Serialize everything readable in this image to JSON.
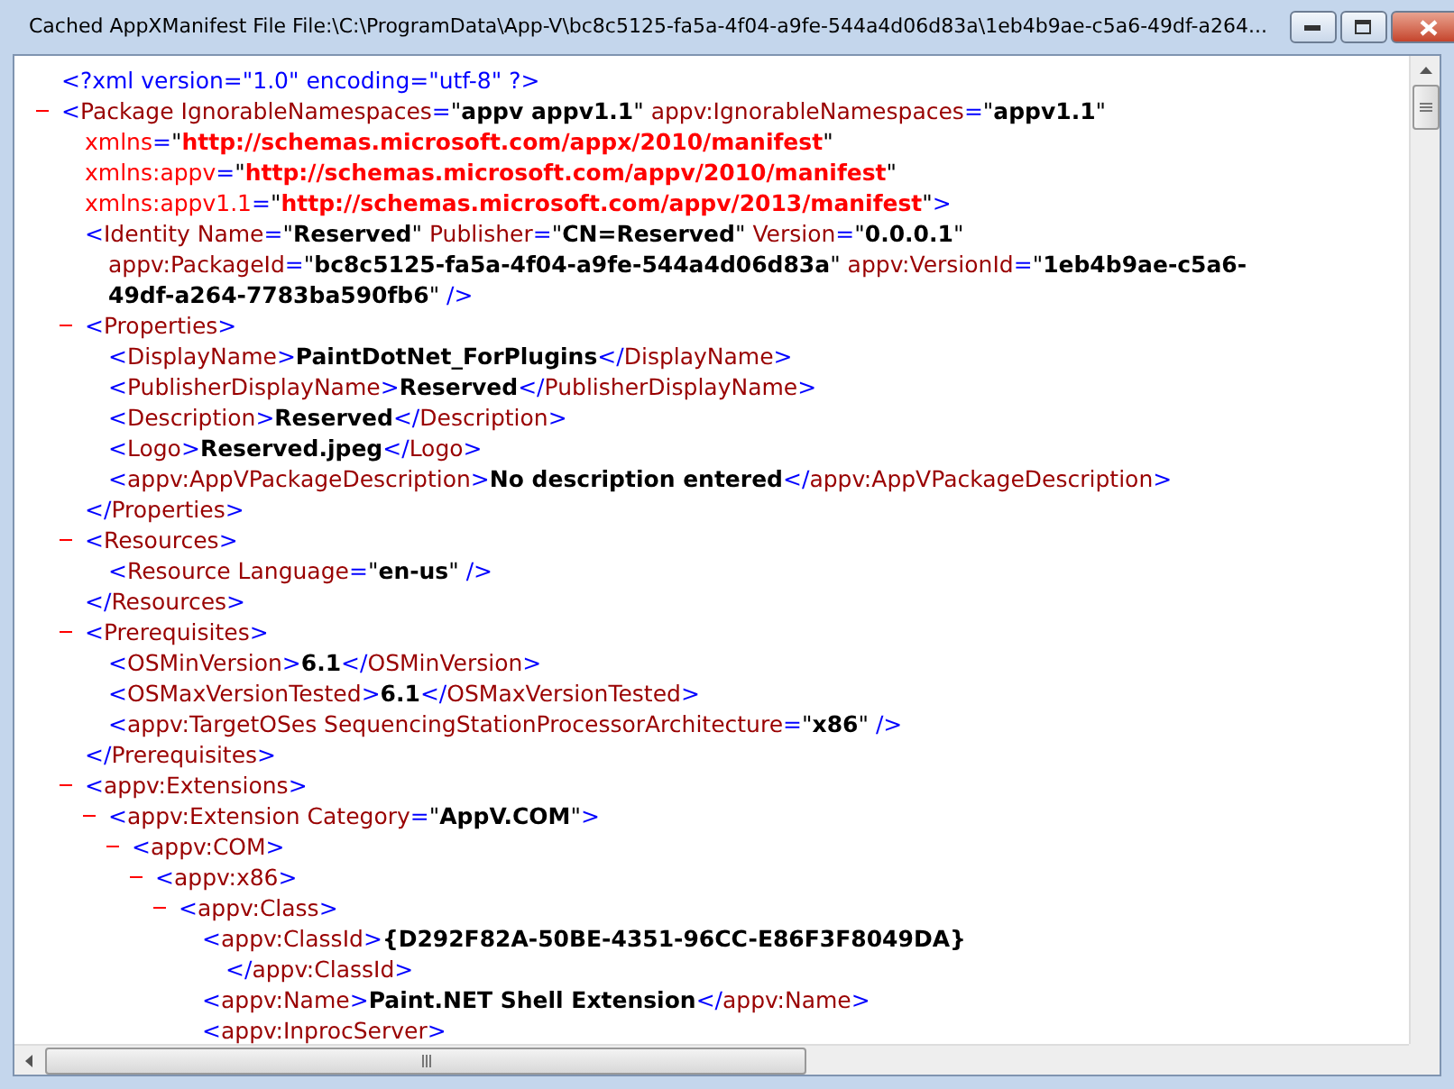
{
  "window": {
    "title": "Cached AppXManifest File File:\\C:\\ProgramData\\App-V\\bc8c5125-fa5a-4f04-a9fe-544a4d06d83a\\1eb4b9ae-c5a6-49df-a264..."
  },
  "document": [
    {
      "lines": [
        [
          {
            "kind": "punct",
            "text": "<?xml version=\"1.0\" encoding=\"utf-8\" ?>"
          }
        ]
      ]
    },
    {
      "expanded": true,
      "lines": [
        [
          {
            "kind": "punct",
            "text": "<"
          },
          {
            "kind": "name",
            "text": "Package IgnorableNamespaces"
          },
          {
            "kind": "punct",
            "text": "="
          },
          {
            "kind": "quote",
            "text": "\""
          },
          {
            "kind": "value",
            "text": "appv appv1.1"
          },
          {
            "kind": "quote",
            "text": "\""
          },
          {
            "kind": "name",
            "text": " appv:IgnorableNamespaces"
          },
          {
            "kind": "punct",
            "text": "="
          },
          {
            "kind": "quote",
            "text": "\""
          },
          {
            "kind": "value",
            "text": "appv1.1"
          },
          {
            "kind": "quote",
            "text": "\""
          }
        ],
        [
          {
            "kind": "nsname",
            "text": "xmlns"
          },
          {
            "kind": "punct",
            "text": "="
          },
          {
            "kind": "quote",
            "text": "\""
          },
          {
            "kind": "url",
            "text": "http://schemas.microsoft.com/appx/2010/manifest"
          },
          {
            "kind": "quote",
            "text": "\""
          }
        ],
        [
          {
            "kind": "nsname",
            "text": "xmlns:appv"
          },
          {
            "kind": "punct",
            "text": "="
          },
          {
            "kind": "quote",
            "text": "\""
          },
          {
            "kind": "url",
            "text": "http://schemas.microsoft.com/appv/2010/manifest"
          },
          {
            "kind": "quote",
            "text": "\""
          }
        ],
        [
          {
            "kind": "nsname",
            "text": "xmlns:appv1.1"
          },
          {
            "kind": "punct",
            "text": "="
          },
          {
            "kind": "quote",
            "text": "\""
          },
          {
            "kind": "url",
            "text": "http://schemas.microsoft.com/appv/2013/manifest"
          },
          {
            "kind": "quote",
            "text": "\""
          },
          {
            "kind": "punct",
            "text": ">"
          }
        ]
      ],
      "children": [
        {
          "lines": [
            [
              {
                "kind": "punct",
                "text": "<"
              },
              {
                "kind": "name",
                "text": "Identity Name"
              },
              {
                "kind": "punct",
                "text": "="
              },
              {
                "kind": "quote",
                "text": "\""
              },
              {
                "kind": "value",
                "text": "Reserved"
              },
              {
                "kind": "quote",
                "text": "\""
              },
              {
                "kind": "name",
                "text": " Publisher"
              },
              {
                "kind": "punct",
                "text": "="
              },
              {
                "kind": "quote",
                "text": "\""
              },
              {
                "kind": "value",
                "text": "CN=Reserved"
              },
              {
                "kind": "quote",
                "text": "\""
              },
              {
                "kind": "name",
                "text": " Version"
              },
              {
                "kind": "punct",
                "text": "="
              },
              {
                "kind": "quote",
                "text": "\""
              },
              {
                "kind": "value",
                "text": "0.0.0.1"
              },
              {
                "kind": "quote",
                "text": "\""
              }
            ],
            [
              {
                "kind": "name",
                "text": "appv:PackageId"
              },
              {
                "kind": "punct",
                "text": "="
              },
              {
                "kind": "quote",
                "text": "\""
              },
              {
                "kind": "value",
                "text": "bc8c5125-fa5a-4f04-a9fe-544a4d06d83a"
              },
              {
                "kind": "quote",
                "text": "\""
              },
              {
                "kind": "name",
                "text": " appv:VersionId"
              },
              {
                "kind": "punct",
                "text": "="
              },
              {
                "kind": "quote",
                "text": "\""
              },
              {
                "kind": "value",
                "text": "1eb4b9ae-c5a6-"
              }
            ],
            [
              {
                "kind": "value",
                "text": "49df-a264-7783ba590fb6"
              },
              {
                "kind": "quote",
                "text": "\""
              },
              {
                "kind": "punct",
                "text": " />"
              }
            ]
          ]
        },
        {
          "expanded": true,
          "lines": [
            [
              {
                "kind": "punct",
                "text": "<"
              },
              {
                "kind": "name",
                "text": "Properties"
              },
              {
                "kind": "punct",
                "text": ">"
              }
            ]
          ],
          "children": [
            {
              "lines": [
                [
                  {
                    "kind": "punct",
                    "text": "<"
                  },
                  {
                    "kind": "name",
                    "text": "DisplayName"
                  },
                  {
                    "kind": "punct",
                    "text": ">"
                  },
                  {
                    "kind": "value",
                    "text": "PaintDotNet_ForPlugins"
                  },
                  {
                    "kind": "punct",
                    "text": "</"
                  },
                  {
                    "kind": "name",
                    "text": "DisplayName"
                  },
                  {
                    "kind": "punct",
                    "text": ">"
                  }
                ]
              ]
            },
            {
              "lines": [
                [
                  {
                    "kind": "punct",
                    "text": "<"
                  },
                  {
                    "kind": "name",
                    "text": "PublisherDisplayName"
                  },
                  {
                    "kind": "punct",
                    "text": ">"
                  },
                  {
                    "kind": "value",
                    "text": "Reserved"
                  },
                  {
                    "kind": "punct",
                    "text": "</"
                  },
                  {
                    "kind": "name",
                    "text": "PublisherDisplayName"
                  },
                  {
                    "kind": "punct",
                    "text": ">"
                  }
                ]
              ]
            },
            {
              "lines": [
                [
                  {
                    "kind": "punct",
                    "text": "<"
                  },
                  {
                    "kind": "name",
                    "text": "Description"
                  },
                  {
                    "kind": "punct",
                    "text": ">"
                  },
                  {
                    "kind": "value",
                    "text": "Reserved"
                  },
                  {
                    "kind": "punct",
                    "text": "</"
                  },
                  {
                    "kind": "name",
                    "text": "Description"
                  },
                  {
                    "kind": "punct",
                    "text": ">"
                  }
                ]
              ]
            },
            {
              "lines": [
                [
                  {
                    "kind": "punct",
                    "text": "<"
                  },
                  {
                    "kind": "name",
                    "text": "Logo"
                  },
                  {
                    "kind": "punct",
                    "text": ">"
                  },
                  {
                    "kind": "value",
                    "text": "Reserved.jpeg"
                  },
                  {
                    "kind": "punct",
                    "text": "</"
                  },
                  {
                    "kind": "name",
                    "text": "Logo"
                  },
                  {
                    "kind": "punct",
                    "text": ">"
                  }
                ]
              ]
            },
            {
              "lines": [
                [
                  {
                    "kind": "punct",
                    "text": "<"
                  },
                  {
                    "kind": "name",
                    "text": "appv:AppVPackageDescription"
                  },
                  {
                    "kind": "punct",
                    "text": ">"
                  },
                  {
                    "kind": "value",
                    "text": "No description entered"
                  },
                  {
                    "kind": "punct",
                    "text": "</"
                  },
                  {
                    "kind": "name",
                    "text": "appv:AppVPackageDescription"
                  },
                  {
                    "kind": "punct",
                    "text": ">"
                  }
                ]
              ]
            }
          ],
          "close": [
            {
              "kind": "punct",
              "text": "</"
            },
            {
              "kind": "name",
              "text": "Properties"
            },
            {
              "kind": "punct",
              "text": ">"
            }
          ]
        },
        {
          "expanded": true,
          "lines": [
            [
              {
                "kind": "punct",
                "text": "<"
              },
              {
                "kind": "name",
                "text": "Resources"
              },
              {
                "kind": "punct",
                "text": ">"
              }
            ]
          ],
          "children": [
            {
              "lines": [
                [
                  {
                    "kind": "punct",
                    "text": "<"
                  },
                  {
                    "kind": "name",
                    "text": "Resource Language"
                  },
                  {
                    "kind": "punct",
                    "text": "="
                  },
                  {
                    "kind": "quote",
                    "text": "\""
                  },
                  {
                    "kind": "value",
                    "text": "en-us"
                  },
                  {
                    "kind": "quote",
                    "text": "\""
                  },
                  {
                    "kind": "punct",
                    "text": " />"
                  }
                ]
              ]
            }
          ],
          "close": [
            {
              "kind": "punct",
              "text": "</"
            },
            {
              "kind": "name",
              "text": "Resources"
            },
            {
              "kind": "punct",
              "text": ">"
            }
          ]
        },
        {
          "expanded": true,
          "lines": [
            [
              {
                "kind": "punct",
                "text": "<"
              },
              {
                "kind": "name",
                "text": "Prerequisites"
              },
              {
                "kind": "punct",
                "text": ">"
              }
            ]
          ],
          "children": [
            {
              "lines": [
                [
                  {
                    "kind": "punct",
                    "text": "<"
                  },
                  {
                    "kind": "name",
                    "text": "OSMinVersion"
                  },
                  {
                    "kind": "punct",
                    "text": ">"
                  },
                  {
                    "kind": "value",
                    "text": "6.1"
                  },
                  {
                    "kind": "punct",
                    "text": "</"
                  },
                  {
                    "kind": "name",
                    "text": "OSMinVersion"
                  },
                  {
                    "kind": "punct",
                    "text": ">"
                  }
                ]
              ]
            },
            {
              "lines": [
                [
                  {
                    "kind": "punct",
                    "text": "<"
                  },
                  {
                    "kind": "name",
                    "text": "OSMaxVersionTested"
                  },
                  {
                    "kind": "punct",
                    "text": ">"
                  },
                  {
                    "kind": "value",
                    "text": "6.1"
                  },
                  {
                    "kind": "punct",
                    "text": "</"
                  },
                  {
                    "kind": "name",
                    "text": "OSMaxVersionTested"
                  },
                  {
                    "kind": "punct",
                    "text": ">"
                  }
                ]
              ]
            },
            {
              "lines": [
                [
                  {
                    "kind": "punct",
                    "text": "<"
                  },
                  {
                    "kind": "name",
                    "text": "appv:TargetOSes SequencingStationProcessorArchitecture"
                  },
                  {
                    "kind": "punct",
                    "text": "="
                  },
                  {
                    "kind": "quote",
                    "text": "\""
                  },
                  {
                    "kind": "value",
                    "text": "x86"
                  },
                  {
                    "kind": "quote",
                    "text": "\""
                  },
                  {
                    "kind": "punct",
                    "text": " />"
                  }
                ]
              ]
            }
          ],
          "close": [
            {
              "kind": "punct",
              "text": "</"
            },
            {
              "kind": "name",
              "text": "Prerequisites"
            },
            {
              "kind": "punct",
              "text": ">"
            }
          ]
        },
        {
          "expanded": true,
          "lines": [
            [
              {
                "kind": "punct",
                "text": "<"
              },
              {
                "kind": "name",
                "text": "appv:Extensions"
              },
              {
                "kind": "punct",
                "text": ">"
              }
            ]
          ],
          "children": [
            {
              "expanded": true,
              "lines": [
                [
                  {
                    "kind": "punct",
                    "text": "<"
                  },
                  {
                    "kind": "name",
                    "text": "appv:Extension Category"
                  },
                  {
                    "kind": "punct",
                    "text": "="
                  },
                  {
                    "kind": "quote",
                    "text": "\""
                  },
                  {
                    "kind": "value",
                    "text": "AppV.COM"
                  },
                  {
                    "kind": "quote",
                    "text": "\""
                  },
                  {
                    "kind": "punct",
                    "text": ">"
                  }
                ]
              ],
              "children": [
                {
                  "expanded": true,
                  "lines": [
                    [
                      {
                        "kind": "punct",
                        "text": "<"
                      },
                      {
                        "kind": "name",
                        "text": "appv:COM"
                      },
                      {
                        "kind": "punct",
                        "text": ">"
                      }
                    ]
                  ],
                  "children": [
                    {
                      "expanded": true,
                      "lines": [
                        [
                          {
                            "kind": "punct",
                            "text": "<"
                          },
                          {
                            "kind": "name",
                            "text": "appv:x86"
                          },
                          {
                            "kind": "punct",
                            "text": ">"
                          }
                        ]
                      ],
                      "children": [
                        {
                          "expanded": true,
                          "lines": [
                            [
                              {
                                "kind": "punct",
                                "text": "<"
                              },
                              {
                                "kind": "name",
                                "text": "appv:Class"
                              },
                              {
                                "kind": "punct",
                                "text": ">"
                              }
                            ]
                          ],
                          "children": [
                            {
                              "lines": [
                                [
                                  {
                                    "kind": "punct",
                                    "text": "<"
                                  },
                                  {
                                    "kind": "name",
                                    "text": "appv:ClassId"
                                  },
                                  {
                                    "kind": "punct",
                                    "text": ">"
                                  },
                                  {
                                    "kind": "value",
                                    "text": "{D292F82A-50BE-4351-96CC-E86F3F8049DA}"
                                  }
                                ],
                                [
                                  {
                                    "kind": "punct",
                                    "text": "</"
                                  },
                                  {
                                    "kind": "name",
                                    "text": "appv:ClassId"
                                  },
                                  {
                                    "kind": "punct",
                                    "text": ">"
                                  }
                                ]
                              ]
                            },
                            {
                              "lines": [
                                [
                                  {
                                    "kind": "punct",
                                    "text": "<"
                                  },
                                  {
                                    "kind": "name",
                                    "text": "appv:Name"
                                  },
                                  {
                                    "kind": "punct",
                                    "text": ">"
                                  },
                                  {
                                    "kind": "value",
                                    "text": "Paint.NET Shell Extension"
                                  },
                                  {
                                    "kind": "punct",
                                    "text": "</"
                                  },
                                  {
                                    "kind": "name",
                                    "text": "appv:Name"
                                  },
                                  {
                                    "kind": "punct",
                                    "text": ">"
                                  }
                                ]
                              ]
                            },
                            {
                              "lines": [
                                [
                                  {
                                    "kind": "punct",
                                    "text": "<"
                                  },
                                  {
                                    "kind": "name",
                                    "text": "appv:InprocServer"
                                  },
                                  {
                                    "kind": "punct",
                                    "text": ">"
                                  }
                                ]
                              ]
                            }
                          ]
                        }
                      ]
                    }
                  ]
                }
              ]
            }
          ]
        }
      ]
    }
  ]
}
